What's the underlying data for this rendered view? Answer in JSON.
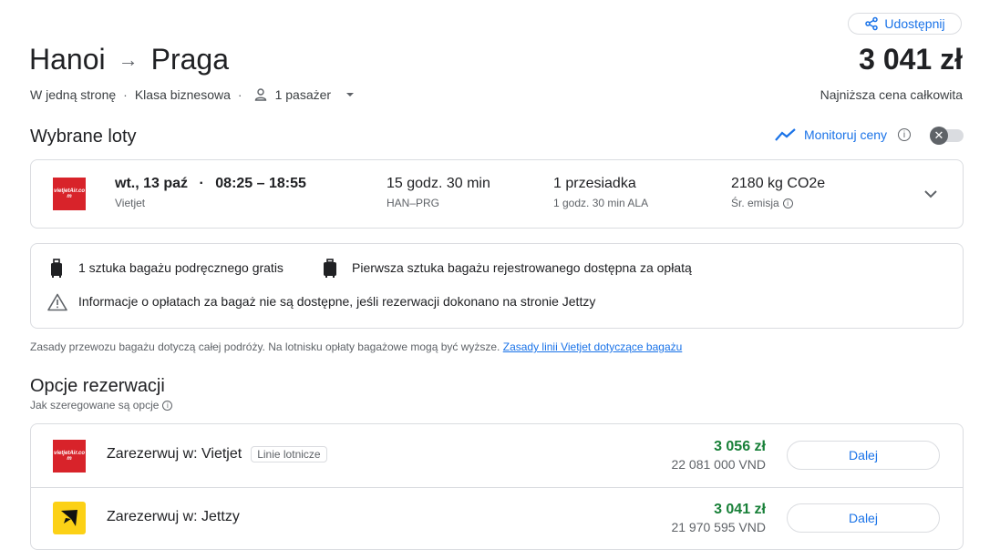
{
  "header": {
    "share_label": "Udostępnij",
    "origin": "Hanoi",
    "destination": "Praga",
    "price": "3 041 zł",
    "price_caption": "Najniższa cena całkowita",
    "trip_type": "W jedną stronę",
    "cabin_class": "Klasa biznesowa",
    "passengers": "1 pasażer"
  },
  "selected": {
    "title": "Wybrane loty",
    "monitor_label": "Monitoruj ceny"
  },
  "flight": {
    "date": "wt., 13 paź",
    "times": "08:25 – 18:55",
    "airline": "Vietjet",
    "duration": "15 godz. 30 min",
    "route": "HAN–PRG",
    "stops": "1 przesiadka",
    "layover": "1 godz. 30 min ALA",
    "emissions": "2180 kg CO2e",
    "emissions_label": "Śr. emisja",
    "logo_text": "vietjetAir.com"
  },
  "baggage": {
    "carry_on": "1 sztuka bagażu podręcznego gratis",
    "checked": "Pierwsza sztuka bagażu rejestrowanego dostępna za opłatą",
    "warning": "Informacje o opłatach za bagaż nie są dostępne, jeśli rezerwacji dokonano na stronie Jettzy",
    "note": "Zasady przewozu bagażu dotyczą całej podróży. Na lotnisku opłaty bagażowe mogą być wyższe.",
    "note_link": "Zasady linii Vietjet dotyczące bagażu"
  },
  "booking": {
    "title": "Opcje rezerwacji",
    "subtitle": "Jak szeregowane są opcje",
    "options": [
      {
        "label": "Zarezerwuj w: Vietjet",
        "tag": "Linie lotnicze",
        "price": "3 056 zł",
        "price_local": "22 081 000 VND",
        "button": "Dalej"
      },
      {
        "label": "Zarezerwuj w: Jettzy",
        "tag": "",
        "price": "3 041 zł",
        "price_local": "21 970 595 VND",
        "button": "Dalej"
      }
    ]
  },
  "colors": {
    "accent": "#1a73e8",
    "price_green": "#188038",
    "vietjet_red": "#d8232a",
    "jettzy_yellow": "#fcd116"
  }
}
